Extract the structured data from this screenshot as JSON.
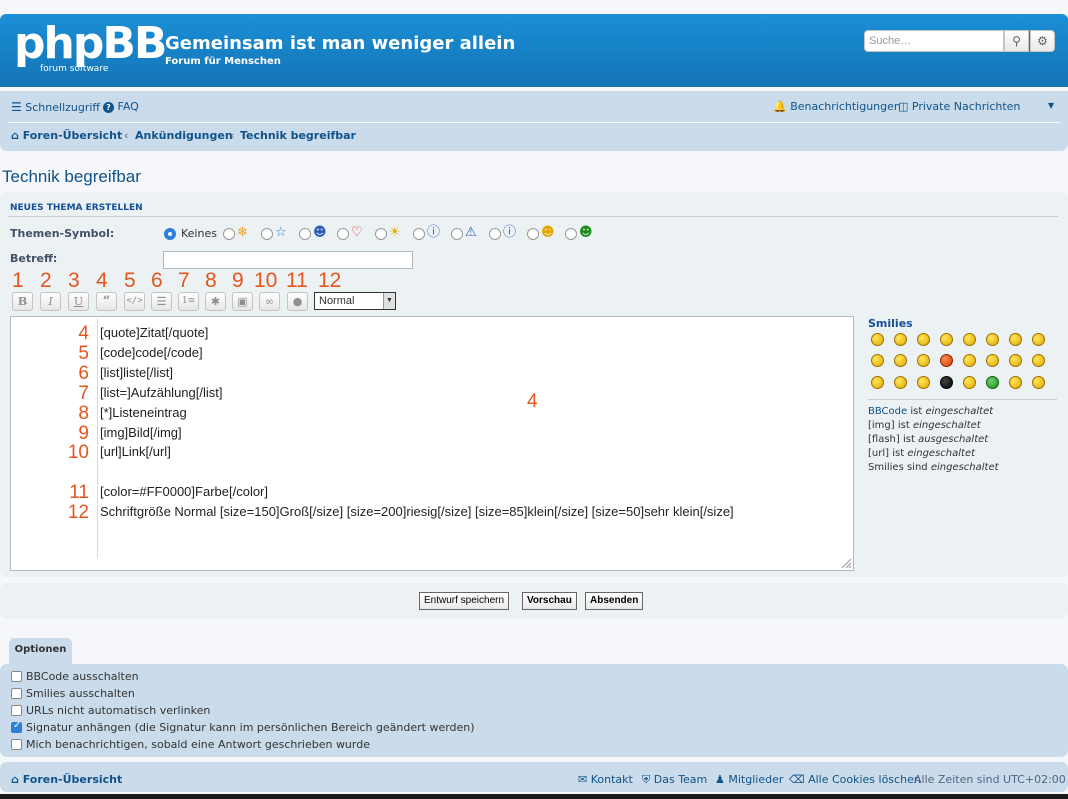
{
  "header": {
    "logo_text": "phpBB",
    "logo_sub": "forum  software",
    "site_title": "Gemeinsam ist man weniger allein",
    "site_desc": "Forum für Menschen",
    "search_placeholder": "Suche…"
  },
  "navbar": {
    "quick_links": "Schnellzugriff",
    "faq": "FAQ",
    "notifications": "Benachrichtigungen",
    "private_messages": "Private Nachrichten",
    "breadcrumbs": [
      "Foren-Übersicht",
      "Ankündigungen",
      "Technik begreifbar"
    ]
  },
  "page_title": "Technik begreifbar",
  "form": {
    "heading": "NEUES THEMA ERSTELLEN",
    "topic_icon_label": "Themen-Symbol:",
    "topic_icon_none": "Keines",
    "subject_label": "Betreff:",
    "font_size_value": "Normal"
  },
  "annotations": {
    "toolbar_numbers": [
      "1",
      "2",
      "3",
      "4",
      "5",
      "6",
      "7",
      "8",
      "9",
      "10",
      "11",
      "12"
    ],
    "center_number": "4"
  },
  "editor_lines": [
    {
      "num": "4",
      "text": "[quote]Zitat[/quote]"
    },
    {
      "num": "5",
      "text": "[code]code[/code]"
    },
    {
      "num": "6",
      "text": "[list]liste[/list]"
    },
    {
      "num": "7",
      "text": "[list=]Aufzählung[/list]"
    },
    {
      "num": "8",
      "text": "[*]Listeneintrag"
    },
    {
      "num": "9",
      "text": "[img]Bild[/img]"
    },
    {
      "num": "10",
      "text": "[url]Link[/url]"
    },
    {
      "num": "11",
      "text": "[color=#FF0000]Farbe[/color]"
    },
    {
      "num": "12",
      "text": "Schriftgröße Normal [size=150]Groß[/size] [size=200]riesig[/size] [size=85]klein[/size] [size=50]sehr klein[/size]"
    }
  ],
  "smilies": {
    "title": "Smilies",
    "status": [
      {
        "pre": "BBCode",
        "mid": " ist ",
        "state": "eingeschaltet"
      },
      {
        "pre": "[img]",
        "mid": " ist ",
        "state": "eingeschaltet"
      },
      {
        "pre": "[flash]",
        "mid": " ist ",
        "state": "ausgeschaltet"
      },
      {
        "pre": "[url]",
        "mid": " ist ",
        "state": "eingeschaltet"
      },
      {
        "pre": "Smilies",
        "mid": " sind ",
        "state": "eingeschaltet"
      }
    ]
  },
  "buttons": {
    "save_draft": "Entwurf speichern",
    "preview": "Vorschau",
    "submit": "Absenden"
  },
  "options": {
    "tab": "Optionen",
    "items": [
      {
        "label": "BBCode ausschalten",
        "checked": false
      },
      {
        "label": "Smilies ausschalten",
        "checked": false
      },
      {
        "label": "URLs nicht automatisch verlinken",
        "checked": false
      },
      {
        "label": "Signatur anhängen (die Signatur kann im persönlichen Bereich geändert werden)",
        "checked": true
      },
      {
        "label": "Mich benachrichtigen, sobald eine Antwort geschrieben wurde",
        "checked": false
      }
    ]
  },
  "footer": {
    "index": "Foren-Übersicht",
    "contact": "Kontakt",
    "team": "Das Team",
    "members": "Mitglieder",
    "delete_cookies": "Alle Cookies löschen",
    "timezone": "Alle Zeiten sind UTC+02:00"
  },
  "colors": {
    "header_blue": "#1474b6",
    "nav_bg": "#cadceb",
    "annotation_orange": "#e5561e",
    "link_blue": "#105289"
  }
}
